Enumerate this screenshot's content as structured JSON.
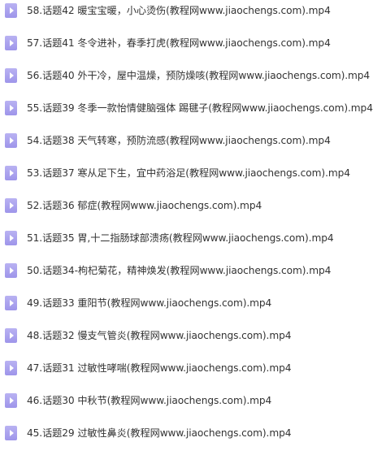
{
  "files": [
    {
      "name": "58.话题42 暖宝宝暖，小心烫伤(教程网www.jiaochengs.com).mp4",
      "icon": "video-file-icon"
    },
    {
      "name": "57.话题41 冬令进补，春季打虎(教程网www.jiaochengs.com).mp4",
      "icon": "video-file-icon"
    },
    {
      "name": "56.话题40 外干冷，屋中温燥，预防燥咳(教程网www.jiaochengs.com).mp4",
      "icon": "video-file-icon"
    },
    {
      "name": "55.话题39 冬季一款怡情健脑强体 踢毽子(教程网www.jiaochengs.com).mp4",
      "icon": "video-file-icon"
    },
    {
      "name": "54.话题38 天气转寒，预防流感(教程网www.jiaochengs.com).mp4",
      "icon": "video-file-icon"
    },
    {
      "name": "53.话题37 寒从足下生，宜中药浴足(教程网www.jiaochengs.com).mp4",
      "icon": "video-file-icon"
    },
    {
      "name": "52.话题36 郁症(教程网www.jiaochengs.com).mp4",
      "icon": "video-file-icon"
    },
    {
      "name": "51.话题35 胃,十二指肠球部溃疡(教程网www.jiaochengs.com).mp4",
      "icon": "video-file-icon"
    },
    {
      "name": "50.话题34-枸杞菊花，精神焕发(教程网www.jiaochengs.com).mp4",
      "icon": "video-file-icon"
    },
    {
      "name": "49.话题33 重阳节(教程网www.jiaochengs.com).mp4",
      "icon": "video-file-icon"
    },
    {
      "name": "48.话题32 慢支气管炎(教程网www.jiaochengs.com).mp4",
      "icon": "video-file-icon"
    },
    {
      "name": "47.话题31 过敏性哮喘(教程网www.jiaochengs.com).mp4",
      "icon": "video-file-icon"
    },
    {
      "name": "46.话题30 中秋节(教程网www.jiaochengs.com).mp4",
      "icon": "video-file-icon"
    },
    {
      "name": "45.话题29 过敏性鼻炎(教程网www.jiaochengs.com).mp4",
      "icon": "video-file-icon"
    }
  ],
  "colors": {
    "icon_fill": "#a89ff0",
    "text": "#333333",
    "background": "#ffffff"
  }
}
